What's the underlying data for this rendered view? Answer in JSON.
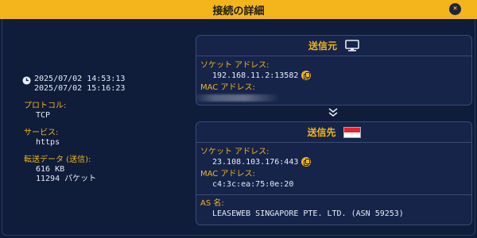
{
  "window": {
    "title": "接続の詳細",
    "close_label": "×"
  },
  "details": {
    "times": [
      "2025/07/02 14:53:13",
      "2025/07/02 15:16:23"
    ],
    "protocol_label": "プロトコル:",
    "protocol": "TCP",
    "service_label": "サービス:",
    "service": "https",
    "transfer_label": "転送データ (送信):",
    "transfer_size": "616 KB",
    "transfer_packets": "11294 パケット"
  },
  "source": {
    "title": "送信元",
    "icon": "monitor-icon",
    "socket_label": "ソケット アドレス:",
    "socket": "192.168.11.2:13582",
    "mac_label": "MAC アドレス:"
  },
  "destination": {
    "title": "送信先",
    "flag": "singapore-flag-icon",
    "socket_label": "ソケット アドレス:",
    "socket": "23.108.103.176:443",
    "mac_label": "MAC アドレス:",
    "mac": "c4:3c:ea:75:0e:20",
    "as_label": "AS 名:",
    "as_name": "LEASEWEB SINGAPORE PTE. LTD. (ASN 59253)"
  },
  "colors": {
    "accent": "#f3b51b",
    "background": "#0f1c3a",
    "panel": "#16244a"
  }
}
